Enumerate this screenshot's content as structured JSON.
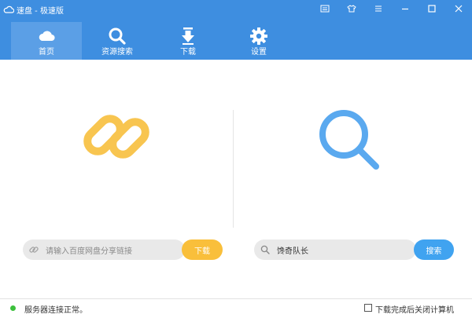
{
  "window": {
    "title": "速盘 - 极速版",
    "controls": [
      "list-icon",
      "skin-icon",
      "menu-icon",
      "minimize-icon",
      "maximize-icon",
      "close-icon"
    ]
  },
  "nav": {
    "items": [
      {
        "label": "首页",
        "icon": "cloud-icon",
        "active": true
      },
      {
        "label": "资源搜索",
        "icon": "search-icon",
        "active": false
      },
      {
        "label": "下载",
        "icon": "download-icon",
        "active": false
      },
      {
        "label": "设置",
        "icon": "gear-icon",
        "active": false
      }
    ]
  },
  "left_panel": {
    "icon": "link-icon",
    "input_placeholder": "请输入百度网盘分享链接",
    "button_label": "下载"
  },
  "right_panel": {
    "icon": "search-icon",
    "input_value": "馋奇队长",
    "button_label": "搜索"
  },
  "status": {
    "text": "服务器连接正常。",
    "checkbox_label": "下载完成后关闭计算机",
    "checkbox_checked": false
  },
  "colors": {
    "header": "#3e8ee0",
    "active_tab": "#5b9fe6",
    "link_icon": "#f8c550",
    "search_icon": "#5aa9ef",
    "download_button": "#f9bf3b",
    "search_button": "#40a3f0",
    "status_ok": "#3cc03c"
  }
}
